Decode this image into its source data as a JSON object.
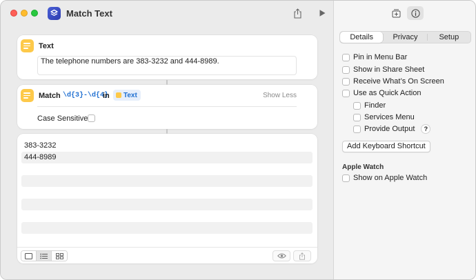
{
  "window": {
    "title": "Match Text"
  },
  "text_action": {
    "title": "Text",
    "value": "The telephone numbers are 383-3232 and 444-8989."
  },
  "match_action": {
    "title": "Match",
    "pattern": "\\d{3}-\\d{4}",
    "in_label": "in",
    "input_token": "Text",
    "toggle_label": "Show Less",
    "case_label": "Case Sensitive:",
    "case_checked": false
  },
  "results": {
    "rows": [
      "383-3232",
      "444-8989",
      "",
      "",
      "",
      "",
      "",
      ""
    ]
  },
  "inspector": {
    "tabs": [
      {
        "label": "Details",
        "selected": true
      },
      {
        "label": "Privacy",
        "selected": false
      },
      {
        "label": "Setup",
        "selected": false
      }
    ],
    "options": {
      "pin_menu_bar": "Pin in Menu Bar",
      "share_sheet": "Show in Share Sheet",
      "receive_screen": "Receive What’s On Screen",
      "quick_action": "Use as Quick Action",
      "finder": "Finder",
      "services": "Services Menu",
      "provide_output": "Provide Output"
    },
    "help_glyph": "?",
    "keyboard_shortcut_button": "Add Keyboard Shortcut",
    "apple_watch_heading": "Apple Watch",
    "apple_watch_option": "Show on Apple Watch"
  },
  "colors": {
    "accent": "#1f6fd1",
    "app_icon": "#3446c4",
    "text_action_icon": "#fdc94a"
  },
  "icons": {
    "app": "shortcuts-layers-icon",
    "share": "share-icon",
    "run": "play-icon",
    "add_to_dock": "add-to-dock-icon",
    "info": "info-icon",
    "eye": "eye-icon"
  }
}
